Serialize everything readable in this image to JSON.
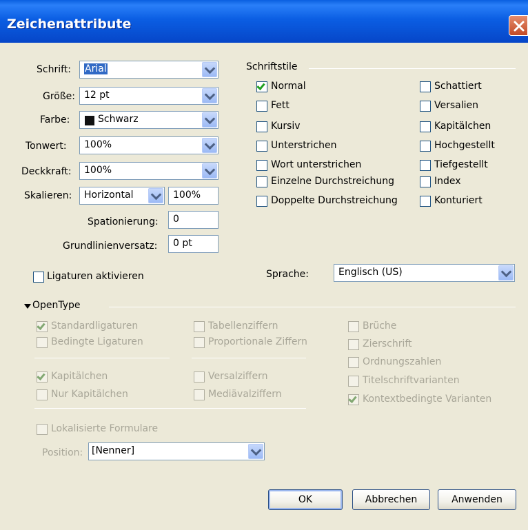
{
  "window": {
    "title": "Zeichenattribute"
  },
  "labels": {
    "schrift": "Schrift:",
    "groesse": "Größe:",
    "farbe": "Farbe:",
    "tonwert": "Tonwert:",
    "deckkraft": "Deckkraft:",
    "skalieren": "Skalieren:",
    "spationierung": "Spationierung:",
    "grundlinie": "Grundlinienversatz:",
    "sprache": "Sprache:"
  },
  "values": {
    "schrift": "Arial",
    "groesse": "12 pt",
    "farbe": "Schwarz",
    "tonwert": "100%",
    "deckkraft": "100%",
    "skalieren_mode": "Horizontal",
    "skalieren_value": "100%",
    "spationierung": "0",
    "grundlinie": "0 pt",
    "sprache": "Englisch (US)"
  },
  "schriftstile": {
    "title": "Schriftstile",
    "left": [
      {
        "label": "Normal",
        "checked": true
      },
      {
        "label": "Fett",
        "checked": false
      },
      {
        "label": "Kursiv",
        "checked": false
      },
      {
        "label": "Unterstrichen",
        "checked": false
      },
      {
        "label": "Wort unterstrichen",
        "checked": false
      },
      {
        "label": "Einzelne Durchstreichung",
        "checked": false
      },
      {
        "label": "Doppelte Durchstreichung",
        "checked": false
      }
    ],
    "right": [
      {
        "label": "Schattiert",
        "checked": false
      },
      {
        "label": "Versalien",
        "checked": false
      },
      {
        "label": "Kapitälchen",
        "checked": false
      },
      {
        "label": "Hochgestellt",
        "checked": false
      },
      {
        "label": "Tiefgestellt",
        "checked": false
      },
      {
        "label": "Index",
        "checked": false
      },
      {
        "label": "Konturiert",
        "checked": false
      }
    ]
  },
  "ligaturen": {
    "label": "Ligaturen aktivieren",
    "checked": false
  },
  "opentype": {
    "title": "OpenType",
    "col1": [
      {
        "label": "Standardligaturen",
        "checked": true
      },
      {
        "label": "Bedingte Ligaturen",
        "checked": false
      },
      {
        "label": "Kapitälchen",
        "checked": true
      },
      {
        "label": "Nur Kapitälchen",
        "checked": false
      }
    ],
    "col2": [
      {
        "label": "Tabellenziffern",
        "checked": false
      },
      {
        "label": "Proportionale Ziffern",
        "checked": false
      },
      {
        "label": "Versalziffern",
        "checked": false
      },
      {
        "label": "Mediävalziffern",
        "checked": false
      }
    ],
    "col3": [
      {
        "label": "Brüche",
        "checked": false
      },
      {
        "label": "Zierschrift",
        "checked": false
      },
      {
        "label": "Ordnungszahlen",
        "checked": false
      },
      {
        "label": "Titelschriftvarianten",
        "checked": false
      },
      {
        "label": "Kontextbedingte Varianten",
        "checked": true
      }
    ],
    "lokal": {
      "label": "Lokalisierte Formulare",
      "checked": false
    },
    "position_label": "Position:",
    "position_value": "[Nenner]"
  },
  "buttons": {
    "ok": "OK",
    "abbrechen": "Abbrechen",
    "anwenden": "Anwenden"
  }
}
